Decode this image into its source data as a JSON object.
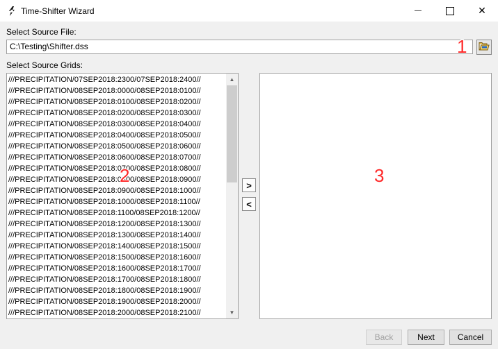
{
  "window": {
    "title": "Time-Shifter Wizard",
    "minimize_glyph": "—",
    "maximize_glyph": "☐",
    "close_glyph": "✕",
    "icon": "time-shifter-app-icon"
  },
  "source_file": {
    "label": "Select Source File:",
    "value": "C:\\Testing\\Shifter.dss",
    "browse_icon": "folder-open-icon"
  },
  "source_grids": {
    "label": "Select Source Grids:",
    "items": [
      "///PRECIPITATION/07SEP2018:2300/07SEP2018:2400//",
      "///PRECIPITATION/08SEP2018:0000/08SEP2018:0100//",
      "///PRECIPITATION/08SEP2018:0100/08SEP2018:0200//",
      "///PRECIPITATION/08SEP2018:0200/08SEP2018:0300//",
      "///PRECIPITATION/08SEP2018:0300/08SEP2018:0400//",
      "///PRECIPITATION/08SEP2018:0400/08SEP2018:0500//",
      "///PRECIPITATION/08SEP2018:0500/08SEP2018:0600//",
      "///PRECIPITATION/08SEP2018:0600/08SEP2018:0700//",
      "///PRECIPITATION/08SEP2018:0700/08SEP2018:0800//",
      "///PRECIPITATION/08SEP2018:0800/08SEP2018:0900//",
      "///PRECIPITATION/08SEP2018:0900/08SEP2018:1000//",
      "///PRECIPITATION/08SEP2018:1000/08SEP2018:1100//",
      "///PRECIPITATION/08SEP2018:1100/08SEP2018:1200//",
      "///PRECIPITATION/08SEP2018:1200/08SEP2018:1300//",
      "///PRECIPITATION/08SEP2018:1300/08SEP2018:1400//",
      "///PRECIPITATION/08SEP2018:1400/08SEP2018:1500//",
      "///PRECIPITATION/08SEP2018:1500/08SEP2018:1600//",
      "///PRECIPITATION/08SEP2018:1600/08SEP2018:1700//",
      "///PRECIPITATION/08SEP2018:1700/08SEP2018:1800//",
      "///PRECIPITATION/08SEP2018:1800/08SEP2018:1900//",
      "///PRECIPITATION/08SEP2018:1900/08SEP2018:2000//",
      "///PRECIPITATION/08SEP2018:2000/08SEP2018:2100//"
    ]
  },
  "transfer": {
    "add_glyph": ">",
    "remove_glyph": "<"
  },
  "annotations": {
    "a1": "1",
    "a2": "2",
    "a3": "3",
    "color": "#ff2a2a"
  },
  "footer": {
    "back_label": "Back",
    "next_label": "Next",
    "cancel_label": "Cancel"
  }
}
